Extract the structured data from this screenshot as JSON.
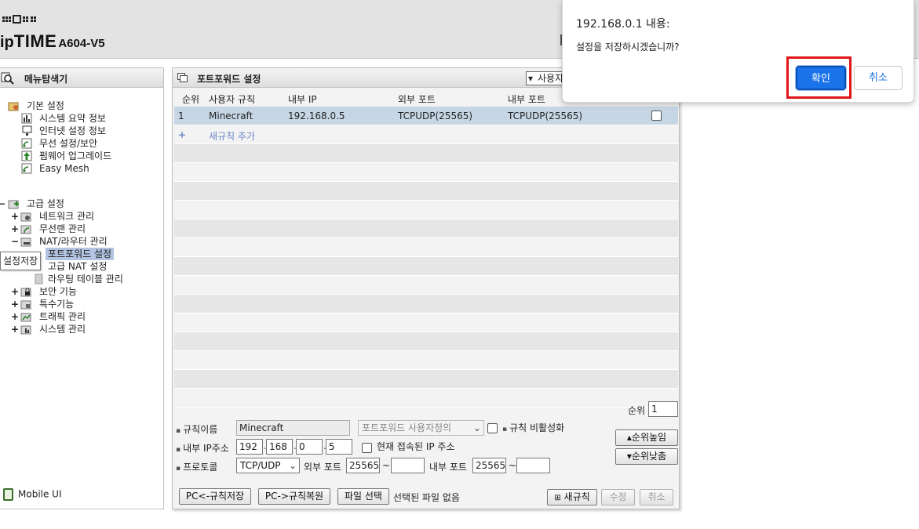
{
  "header": {
    "brand_ip": "ip",
    "brand_time": "TIME",
    "model": "A604-V5"
  },
  "sidebar": {
    "title": "메뉴탐색기",
    "basic": {
      "label": "기본 설정",
      "items": [
        "시스템 요약 정보",
        "인터넷 설정 정보",
        "무선 설정/보안",
        "펌웨어 업그레이드",
        "Easy Mesh"
      ]
    },
    "advanced": {
      "label": "고급 설정",
      "items": [
        {
          "label": "네트워크 관리",
          "pm": "+"
        },
        {
          "label": "무선랜 관리",
          "pm": "+"
        },
        {
          "label": "NAT/라우터 관리",
          "pm": "−"
        },
        {
          "label": "보안 기능",
          "pm": "+"
        },
        {
          "label": "특수기능",
          "pm": "+"
        },
        {
          "label": "트래픽 관리",
          "pm": "+"
        },
        {
          "label": "시스템 관리",
          "pm": "+"
        }
      ],
      "nat_sub": [
        "포트포워드 설정",
        "고급 NAT 설정",
        "라우팅 테이블 관리"
      ]
    },
    "tooltip": "설정저장",
    "mobile_ui": "Mobile UI"
  },
  "main": {
    "title": "포트포워드 설정",
    "list_select": "사용자",
    "columns": [
      "순위",
      "사용자 규칙",
      "내부 IP",
      "외부 포트",
      "내부 포트"
    ],
    "rows": [
      {
        "rank": "1",
        "name": "Minecraft",
        "ip": "192.168.0.5",
        "ext": "TCPUDP(25565)",
        "int": "TCPUDP(25565)"
      }
    ],
    "add_rule": "새규칙 추가",
    "form": {
      "rule_name_label": "규칙이름",
      "rule_name_value": "Minecraft",
      "preset_value": "포트포워드 사용자정의",
      "disable_label": "규칙 비활성화",
      "ip_label": "내부 IP주소",
      "ip1": "192",
      "ip2": "168",
      "ip3": "0",
      "ip4": "5",
      "current_ip_label": "현재 접속된 IP 주소",
      "protocol_label": "프로토콜",
      "protocol_value": "TCP/UDP",
      "ext_port_label": "외부 포트",
      "ext_port_from": "25565",
      "int_port_label": "내부 포트",
      "int_port_from": "25565",
      "tilde": "~",
      "rank_label": "순위",
      "rank_value": "1",
      "up_btn": "순위높임",
      "down_btn": "순위낮춤"
    },
    "buttons": {
      "save_to_pc": "PC<-규칙저장",
      "restore_from_pc": "PC->규칙복원",
      "choose_file": "파일 선택",
      "no_file": "선택된 파일 없음",
      "new_rule": "새규칙",
      "modify": "수정",
      "cancel": "취소"
    }
  },
  "dialog": {
    "title": "192.168.0.1 내용:",
    "message": "설정을 저장하시겠습니까?",
    "ok": "확인",
    "cancel": "취소"
  }
}
